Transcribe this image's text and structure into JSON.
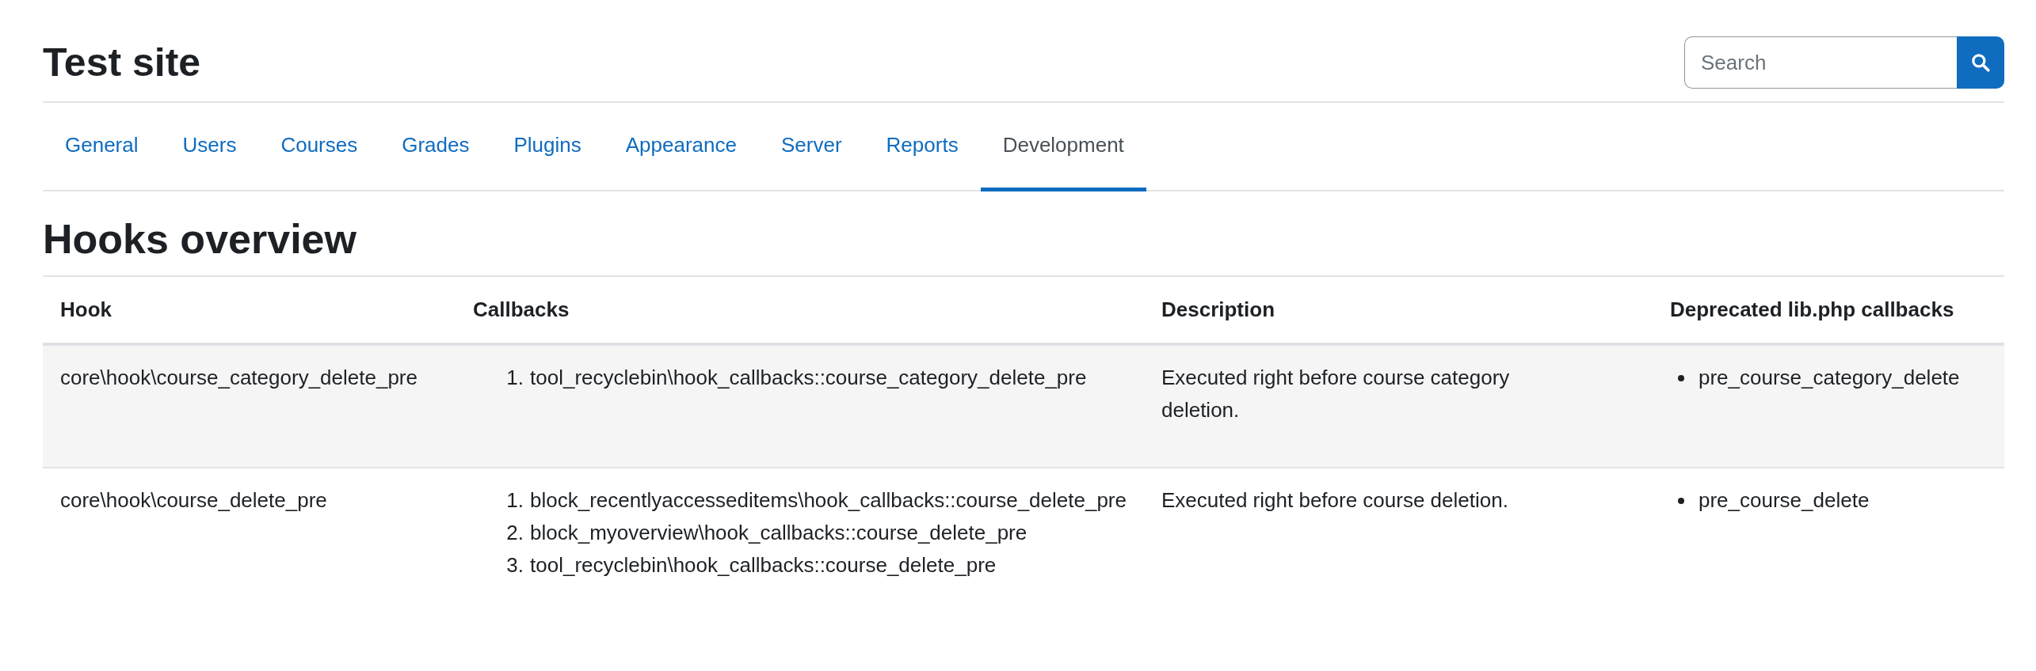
{
  "site_title": "Test site",
  "search": {
    "placeholder": "Search"
  },
  "tabs": [
    {
      "label": "General",
      "selected": false
    },
    {
      "label": "Users",
      "selected": false
    },
    {
      "label": "Courses",
      "selected": false
    },
    {
      "label": "Grades",
      "selected": false
    },
    {
      "label": "Plugins",
      "selected": false
    },
    {
      "label": "Appearance",
      "selected": false
    },
    {
      "label": "Server",
      "selected": false
    },
    {
      "label": "Reports",
      "selected": false
    },
    {
      "label": "Development",
      "selected": true
    }
  ],
  "page_title": "Hooks overview",
  "table": {
    "columns": [
      "Hook",
      "Callbacks",
      "Description",
      "Deprecated lib.php callbacks"
    ],
    "rows": [
      {
        "hook": "core\\hook\\course_category_delete_pre",
        "callbacks": [
          {
            "number": "1.",
            "text": "tool_recyclebin\\hook_callbacks::course_category_delete_pre"
          }
        ],
        "description": "Executed right before course category deletion.",
        "deprecated": [
          "pre_course_category_delete"
        ]
      },
      {
        "hook": "core\\hook\\course_delete_pre",
        "callbacks": [
          {
            "number": "1.",
            "text": "block_recentlyaccesseditems\\hook_callbacks::course_delete_pre"
          },
          {
            "number": "2.",
            "text": "block_myoverview\\hook_callbacks::course_delete_pre"
          },
          {
            "number": "3.",
            "text": "tool_recyclebin\\hook_callbacks::course_delete_pre"
          }
        ],
        "description": "Executed right before course deletion.",
        "deprecated": [
          "pre_course_delete"
        ]
      }
    ]
  }
}
